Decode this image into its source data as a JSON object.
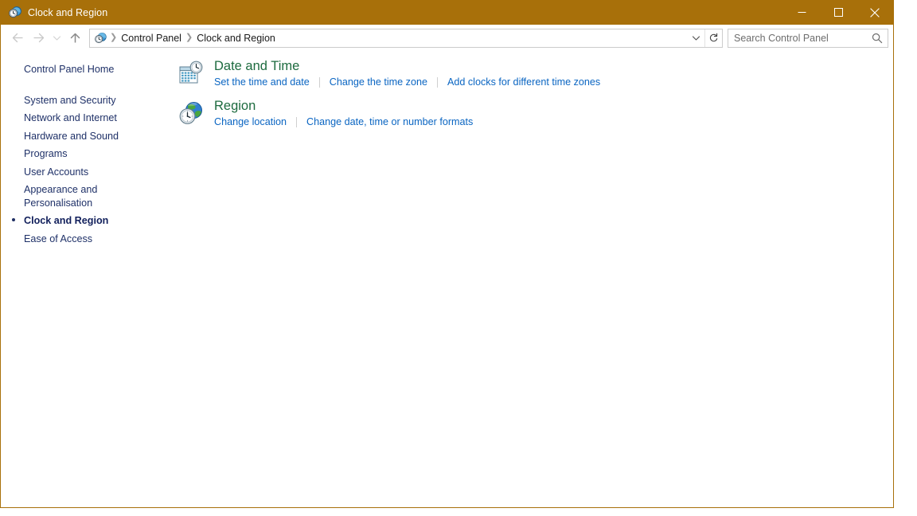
{
  "window": {
    "title": "Clock and Region",
    "title_icon": "clock-region-icon",
    "accent_color": "#a8700a",
    "controls": {
      "minimize": "Minimize",
      "maximize": "Maximize",
      "close": "Close"
    }
  },
  "navbar": {
    "back": "Back",
    "forward": "Forward",
    "recent": "Recent locations",
    "up": "Up one level",
    "breadcrumb_icon": "control-panel-icon",
    "breadcrumbs": [
      "Control Panel",
      "Clock and Region"
    ],
    "breadcrumb_separator": "❯",
    "dropdown": "Previous locations",
    "refresh": "↻",
    "search": {
      "placeholder": "Search Control Panel",
      "value": "",
      "icon": "search-icon"
    }
  },
  "sidebar": {
    "items": [
      {
        "label": "Control Panel Home",
        "selected": false,
        "group": "home"
      },
      {
        "label": "System and Security",
        "selected": false,
        "group": "main"
      },
      {
        "label": "Network and Internet",
        "selected": false,
        "group": "main"
      },
      {
        "label": "Hardware and Sound",
        "selected": false,
        "group": "main"
      },
      {
        "label": "Programs",
        "selected": false,
        "group": "main"
      },
      {
        "label": "User Accounts",
        "selected": false,
        "group": "main"
      },
      {
        "label": "Appearance and Personalisation",
        "selected": false,
        "group": "main"
      },
      {
        "label": "Clock and Region",
        "selected": true,
        "group": "main"
      },
      {
        "label": "Ease of Access",
        "selected": false,
        "group": "main"
      }
    ]
  },
  "content": {
    "categories": [
      {
        "title": "Date and Time",
        "icon": "calendar-clock-icon",
        "links": [
          "Set the time and date",
          "Change the time zone",
          "Add clocks for different time zones"
        ]
      },
      {
        "title": "Region",
        "icon": "globe-clock-icon",
        "links": [
          "Change location",
          "Change date, time or number formats"
        ]
      }
    ]
  },
  "colors": {
    "titlebar": "#a8700a",
    "heading": "#1d6b3f",
    "link": "#0a65c2",
    "sidebar_text": "#1f3168"
  }
}
